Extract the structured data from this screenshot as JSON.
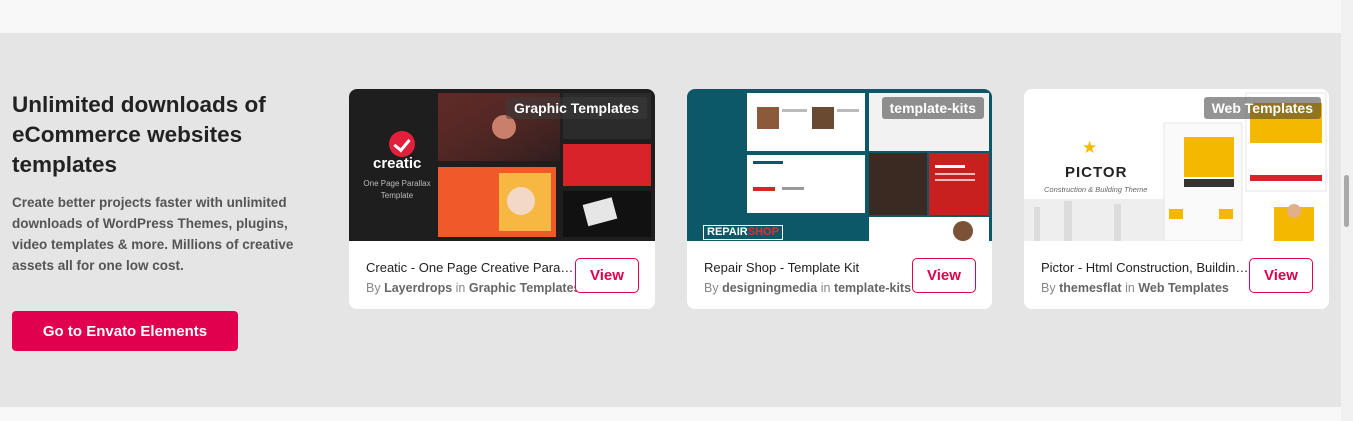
{
  "promo": {
    "heading": "Unlimited downloads of eCommerce websites templates",
    "description": "Create better projects faster with unlimited downloads of WordPress Themes, plugins, video templates & more. Millions of creative assets all for one low cost.",
    "cta_label": "Go to Envato Elements"
  },
  "colors": {
    "accent": "#e0004d",
    "band": "#e5e5e5"
  },
  "cards": [
    {
      "badge": "Graphic Templates",
      "title": "Creatic - One Page Creative Parallax Template",
      "by": "By",
      "author": "Layerdrops",
      "in": "in",
      "category": "Graphic Templates",
      "view_label": "View",
      "thumb_brand": "creatic",
      "thumb_sub": "One Page Parallax Template"
    },
    {
      "badge": "template-kits",
      "title": "Repair Shop - Template Kit",
      "by": "By",
      "author": "designingmedia",
      "in": "in",
      "category": "template-kits",
      "view_label": "View",
      "thumb_brand_a": "REPAIR",
      "thumb_brand_b": "SHOP"
    },
    {
      "badge": "Web Templates",
      "title": "Pictor - Html Construction, Building Template",
      "by": "By",
      "author": "themesflat",
      "in": "in",
      "category": "Web Templates",
      "view_label": "View",
      "thumb_brand": "PICTOR",
      "thumb_sub": "Construction & Building Theme"
    }
  ]
}
